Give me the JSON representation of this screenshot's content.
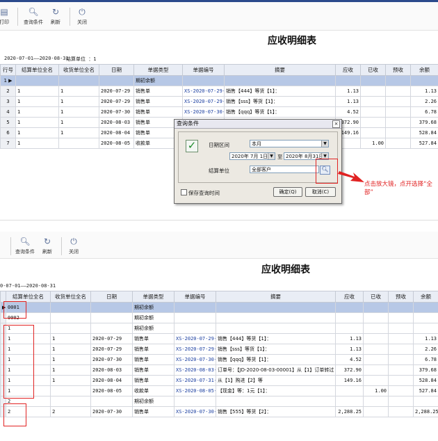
{
  "top": {
    "toolbar": [
      {
        "icon": "printer-icon",
        "label": "打印"
      },
      {
        "icon": "search-icon",
        "label": "查询条件"
      },
      {
        "icon": "refresh-icon",
        "label": "刷新"
      },
      {
        "icon": "power-icon",
        "label": "关闭"
      }
    ],
    "title": "应收明细表",
    "range": "2020-07-01——2020-08-31",
    "unit_label": "结算单位 ：1",
    "columns": [
      "行号",
      "结算单位全名",
      "收货单位全名",
      "日期",
      "单据类型",
      "单据编号",
      "摘要",
      "应收",
      "已收",
      "预收",
      "余额"
    ],
    "rows": [
      [
        "1",
        "",
        "",
        "",
        "期初余额",
        "",
        "",
        "",
        "",
        "",
        ""
      ],
      [
        "2",
        "1",
        "1",
        "2020-07-29",
        "销售单",
        "XS-2020-07-29-00001",
        "销售【444】等货【1】：",
        "1.13",
        "",
        "",
        "1.13"
      ],
      [
        "3",
        "1",
        "1",
        "2020-07-29",
        "销售单",
        "XS-2020-07-29-00002",
        "销售【sss】等货【1】：",
        "1.13",
        "",
        "",
        "2.26"
      ],
      [
        "4",
        "1",
        "1",
        "2020-07-30",
        "销售单",
        "XS-2020-07-30-00001",
        "销售【qqq】等货【1】：",
        "4.52",
        "",
        "",
        "6.78"
      ],
      [
        "5",
        "1",
        "1",
        "2020-08-03",
        "销售单",
        "",
        "",
        "372.90",
        "",
        "",
        "379.68"
      ],
      [
        "6",
        "1",
        "1",
        "2020-08-04",
        "销售单",
        "",
        "",
        "149.16",
        "",
        "",
        "528.84"
      ],
      [
        "7",
        "1",
        "",
        "2020-08-05",
        "收款单",
        "",
        "",
        "",
        "1.00",
        "",
        "527.84"
      ]
    ]
  },
  "dialog": {
    "title": "查询条件",
    "close": "×",
    "date_label": "日期区间",
    "period_value": "本月",
    "from_date": "2020年 7月 1日",
    "to_label": "至",
    "to_date": "2020年 8月31日",
    "unit_label": "结算单位",
    "unit_value": "全部客户",
    "save_label": "保存查询时间",
    "ok_label": "确定(Q)",
    "cancel_label": "取消(C)"
  },
  "annotation": "点击放大镜，点开选择“全部”",
  "bottom": {
    "toolbar": [
      {
        "icon": "search-icon",
        "label": "查询条件"
      },
      {
        "icon": "refresh-icon",
        "label": "刷新"
      },
      {
        "icon": "power-icon",
        "label": "关闭"
      }
    ],
    "title": "应收明细表",
    "range": "0-07-01——2020-08-31",
    "columns": [
      "结算单位全名",
      "收货单位全名",
      "日期",
      "单据类型",
      "单据编号",
      "摘要",
      "应收",
      "已收",
      "预收",
      "余额"
    ],
    "rows": [
      [
        "0001",
        "",
        "",
        "期初余额",
        "",
        "",
        "",
        "",
        "",
        ""
      ],
      [
        "0002",
        "",
        "",
        "期初余额",
        "",
        "",
        "",
        "",
        "",
        ""
      ],
      [
        "1",
        "",
        "",
        "期初余额",
        "",
        "",
        "",
        "",
        "",
        ""
      ],
      [
        "1",
        "1",
        "2020-07-29",
        "销售单",
        "XS-2020-07-29-00001",
        "销售【444】等货【1】：",
        "1.13",
        "",
        "",
        "1.13"
      ],
      [
        "1",
        "1",
        "2020-07-29",
        "销售单",
        "XS-2020-07-29-00002",
        "销售【sss】等货【1】：",
        "1.13",
        "",
        "",
        "2.26"
      ],
      [
        "1",
        "1",
        "2020-07-30",
        "销售单",
        "XS-2020-07-30-00001",
        "销售【qqq】等货【1】：",
        "4.52",
        "",
        "",
        "6.78"
      ],
      [
        "1",
        "1",
        "2020-08-03",
        "销售单",
        "XS-2020-08-03-00001",
        "订单号：【JD-2020-08-03-00001】从【1】订单转过",
        "372.90",
        "",
        "",
        "379.68"
      ],
      [
        "1",
        "1",
        "2020-08-04",
        "销售单",
        "XS-2020-07-31-00001",
        "从【1】购进【2】等",
        "149.16",
        "",
        "",
        "528.84"
      ],
      [
        "1",
        "",
        "2020-08-05",
        "收款单",
        "XS-2020-08-05-00001",
        "【现金】等：1元【1】：",
        "",
        "1.00",
        "",
        "527.84"
      ],
      [
        "2",
        "",
        "",
        "期初余额",
        "",
        "",
        "",
        "",
        "",
        ""
      ],
      [
        "2",
        "2",
        "2020-07-30",
        "销售单",
        "XS-2020-07-30-00002",
        "销售【555】等货【2】：",
        "2,288.25",
        "",
        "",
        "2,288.25"
      ]
    ]
  }
}
